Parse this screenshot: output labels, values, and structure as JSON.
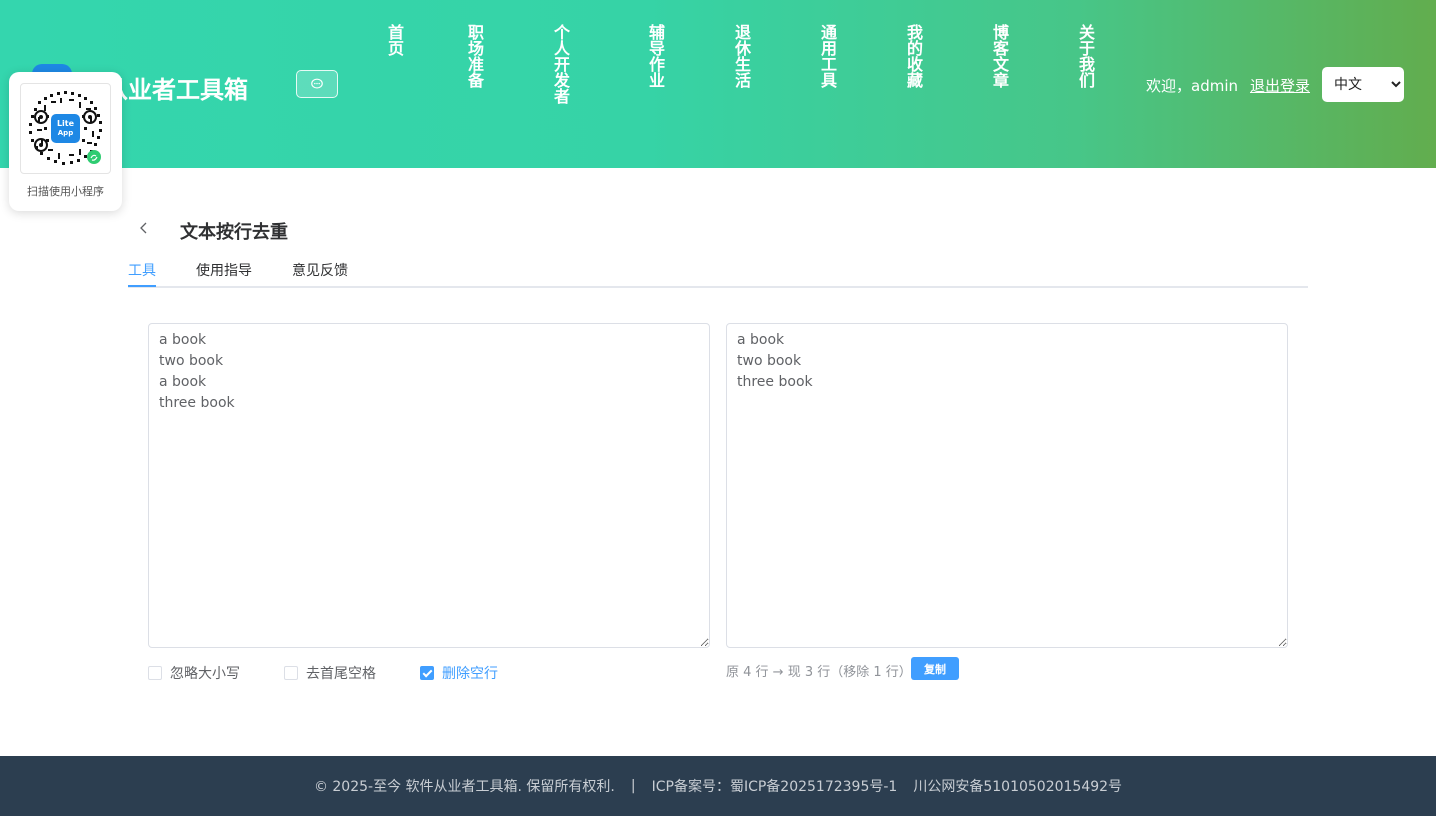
{
  "header": {
    "site_title": "件从业者工具箱",
    "nav": [
      {
        "label": "首页"
      },
      {
        "label": "职场准备"
      },
      {
        "label": "个人开发者"
      },
      {
        "label": "辅导作业"
      },
      {
        "label": "退休生活"
      },
      {
        "label": "通用工具"
      },
      {
        "label": "我的收藏"
      },
      {
        "label": "博客文章"
      },
      {
        "label": "关于我们"
      }
    ],
    "welcome": "欢迎，admin",
    "logout": "退出登录",
    "language": {
      "selected": "中文"
    }
  },
  "qr_card": {
    "label": "扫描使用小程序",
    "logo_text_1": "Lite",
    "logo_text_2": "App"
  },
  "page": {
    "title": "文本按行去重",
    "tabs": [
      {
        "label": "工具"
      },
      {
        "label": "使用指导"
      },
      {
        "label": "意见反馈"
      }
    ]
  },
  "tool": {
    "input_text": "a book\ntwo book\na book\nthree book",
    "output_text": "a book\ntwo book\nthree book",
    "options": [
      {
        "label": "忽略大小写",
        "checked": false
      },
      {
        "label": "去首尾空格",
        "checked": false
      },
      {
        "label": "删除空行",
        "checked": true
      }
    ],
    "stats": "原 4 行 → 现 3 行（移除 1 行）",
    "copy_label": "复制"
  },
  "footer": {
    "copyright": "© 2025-至今 软件从业者工具箱. 保留所有权利.",
    "separator": "|",
    "icp": "ICP备案号：蜀ICP备2025172395号-1",
    "police": "川公网安备51010502015492号"
  },
  "colors": {
    "accent": "#409eff",
    "header_start": "#34d6ae",
    "header_end": "#62ad4e",
    "footer_bg": "#2c3e50"
  }
}
